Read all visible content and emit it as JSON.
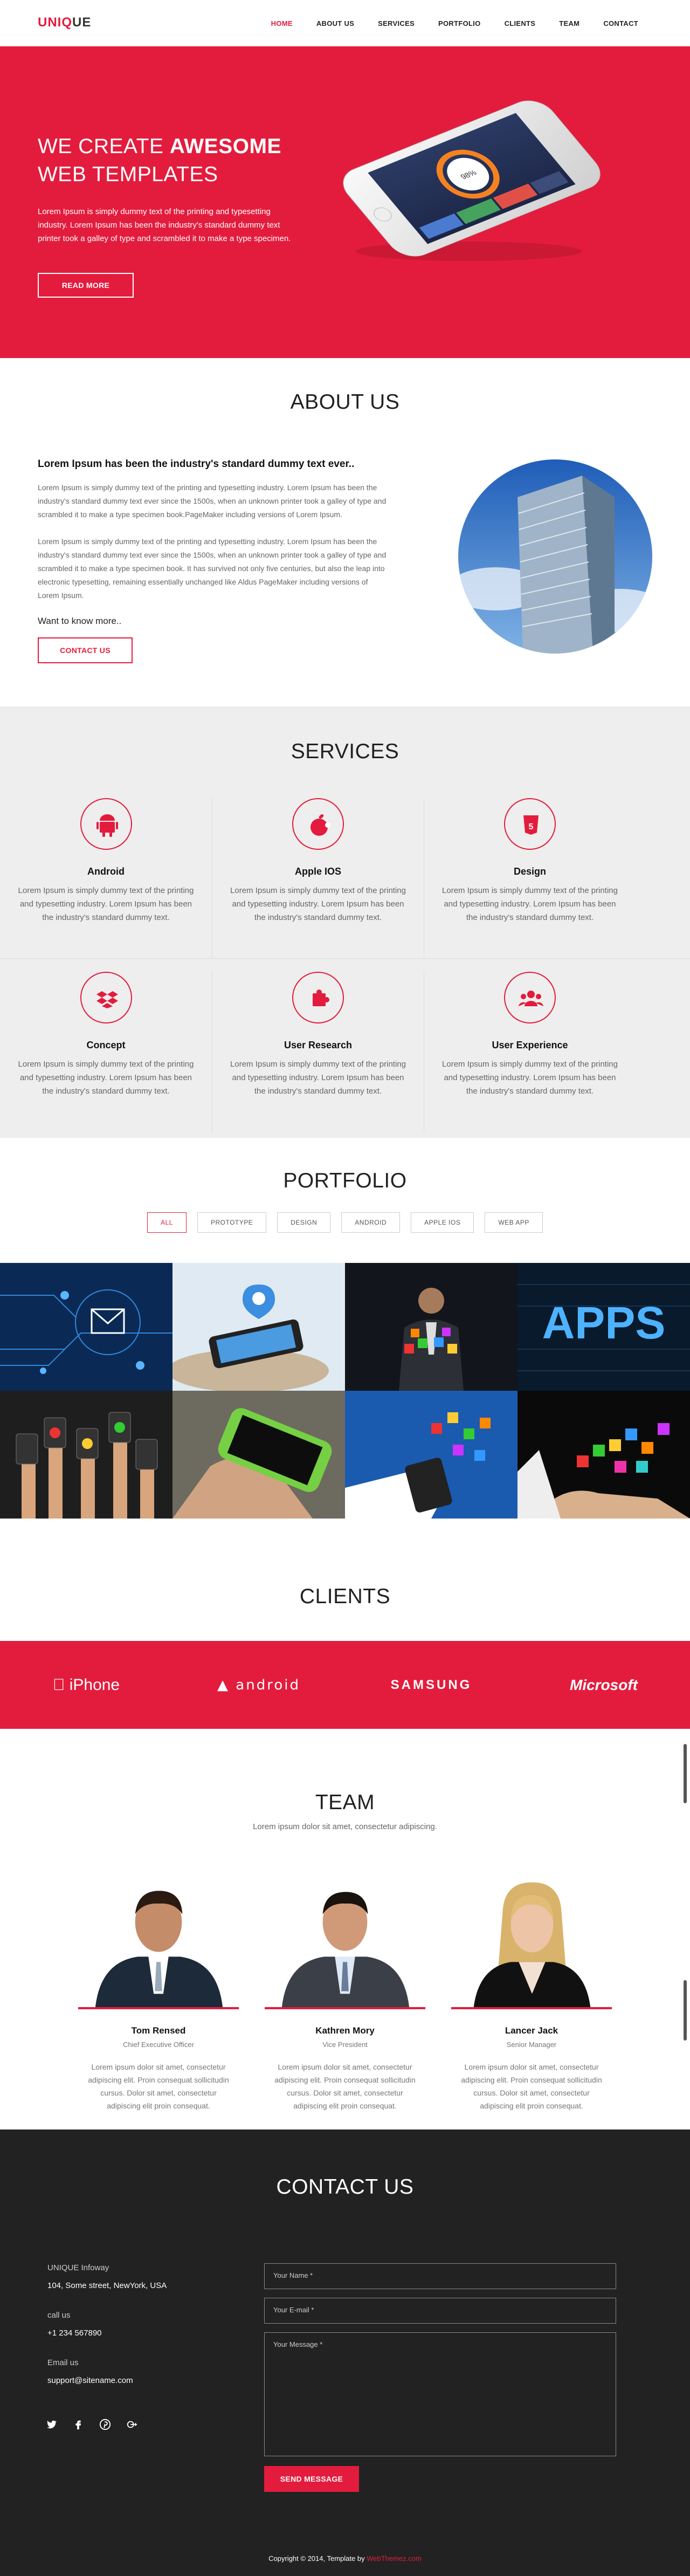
{
  "nav": {
    "logo_red": "UNIQ",
    "logo_dark": "UE",
    "items": [
      "HOME",
      "ABOUT US",
      "SERVICES",
      "PORTFOLIO",
      "CLIENTS",
      "TEAM",
      "CONTACT"
    ]
  },
  "hero": {
    "line1": "WE CREATE ",
    "line1_bold": "AWESOME",
    "line2": "WEB TEMPLATES",
    "text": "Lorem Ipsum is simply dummy text of the printing and typesetting industry. Lorem Ipsum has been the industry's standard dummy text printer took a galley of type and scrambled it to make a type specimen.",
    "button": "READ MORE"
  },
  "about": {
    "title": "ABOUT US",
    "heading": "Lorem Ipsum has been the industry's standard dummy text ever..",
    "p1": "Lorem Ipsum is simply dummy text of the printing and typesetting industry. Lorem Ipsum has been the industry's standard dummy text ever since the 1500s, when an unknown printer took a galley of type and scrambled it to make a type specimen book.PageMaker including versions of Lorem Ipsum.",
    "p2": "Lorem Ipsum is simply dummy text of the printing and typesetting industry. Lorem Ipsum has been the industry's standard dummy text ever since the 1500s, when an unknown printer took a galley of type and scrambled it to make a type specimen book. It has survived not only five centuries, but also the leap into electronic typesetting, remaining essentially unchanged like Aldus PageMaker including versions of Lorem Ipsum.",
    "more": "Want to know more..",
    "button": "CONTACT US"
  },
  "services": {
    "title": "SERVICES",
    "items": [
      {
        "name": "Android",
        "icon": "android-icon",
        "text": "Lorem Ipsum is simply dummy text of the printing and typesetting industry. Lorem Ipsum has been the industry's standard dummy text."
      },
      {
        "name": "Apple IOS",
        "icon": "apple-icon",
        "text": "Lorem Ipsum is simply dummy text of the printing and typesetting industry. Lorem Ipsum has been the industry's standard dummy text."
      },
      {
        "name": "Design",
        "icon": "html5-icon",
        "text": "Lorem Ipsum is simply dummy text of the printing and typesetting industry. Lorem Ipsum has been the industry's standard dummy text."
      },
      {
        "name": "Concept",
        "icon": "dropbox-icon",
        "text": "Lorem Ipsum is simply dummy text of the printing and typesetting industry. Lorem Ipsum has been the industry's standard dummy text."
      },
      {
        "name": "User Research",
        "icon": "puzzle-icon",
        "text": "Lorem Ipsum is simply dummy text of the printing and typesetting industry. Lorem Ipsum has been the industry's standard dummy text."
      },
      {
        "name": "User Experience",
        "icon": "users-icon",
        "text": "Lorem Ipsum is simply dummy text of the printing and typesetting industry. Lorem Ipsum has been the industry's standard dummy text."
      }
    ]
  },
  "portfolio": {
    "title": "PORTFOLIO",
    "filters": [
      "ALL",
      "PROTOTYPE",
      "DESIGN",
      "ANDROID",
      "APPLE IOS",
      "WEB APP"
    ],
    "apps_text": "APPS"
  },
  "clients": {
    "title": "CLIENTS",
    "logos": [
      "iPhone",
      "ANDROID",
      "SAMSUNG",
      "Microsoft"
    ]
  },
  "team": {
    "title": "TEAM",
    "subtitle": "Lorem ipsum dolor sit amet, consectetur adipiscing.",
    "members": [
      {
        "name": "Tom Rensed",
        "role": "Chief Executive Officer",
        "text": "Lorem ipsum dolor sit amet, consectetur adipiscing elit. Proin consequat sollicitudin cursus. Dolor sit amet, consectetur adipiscing elit proin consequat."
      },
      {
        "name": "Kathren Mory",
        "role": "Vice President",
        "text": "Lorem ipsum dolor sit amet, consectetur adipiscing elit. Proin consequat sollicitudin cursus. Dolor sit amet, consectetur adipiscing elit proin consequat."
      },
      {
        "name": "Lancer Jack",
        "role": "Senior Manager",
        "text": "Lorem ipsum dolor sit amet, consectetur adipiscing elit. Proin consequat sollicitudin cursus. Dolor sit amet, consectetur adipiscing elit proin consequat."
      }
    ]
  },
  "contact": {
    "title": "CONTACT US",
    "company": "UNIQUE Infoway",
    "address": "104, Some street, NewYork, USA",
    "call_label": "call us",
    "phone": "+1 234 567890",
    "email_label": "Email us",
    "email": "support@sitename.com",
    "name_placeholder": "Your Name *",
    "email_placeholder": "Your E-mail *",
    "message_placeholder": "Your Message *",
    "button": "SEND MESSAGE"
  },
  "footer": {
    "copy": "Copyright © 2014, Template by ",
    "link": "WebThemez.com"
  },
  "colors": {
    "accent": "#e31c3d",
    "dark": "#222222",
    "light_bg": "#eeeeee"
  }
}
